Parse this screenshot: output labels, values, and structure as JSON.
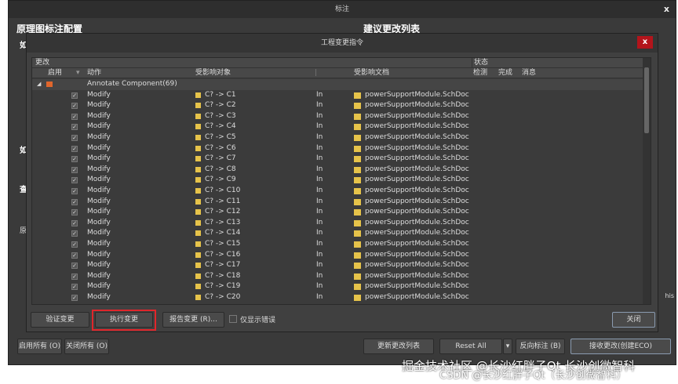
{
  "window": {
    "title": "标注",
    "close": "x",
    "left_section": "原理图标注配置",
    "right_section": "建议更改列表",
    "left_frag": [
      "如",
      "如",
      "查",
      "原"
    ]
  },
  "dialog": {
    "title": "工程变更指令",
    "close": "x",
    "header": {
      "group": "更改",
      "status": "状态",
      "cols": [
        "启用",
        "动作",
        "受影响对象",
        "受影响文档",
        "检测",
        "完成",
        "消息"
      ]
    },
    "group_row": "Annotate Component(69)",
    "rows": [
      {
        "action": "Modify",
        "object": "C? -> C1",
        "dir": "In",
        "doc": "powerSupportModule.SchDoc"
      },
      {
        "action": "Modify",
        "object": "C? -> C2",
        "dir": "In",
        "doc": "powerSupportModule.SchDoc"
      },
      {
        "action": "Modify",
        "object": "C? -> C3",
        "dir": "In",
        "doc": "powerSupportModule.SchDoc"
      },
      {
        "action": "Modify",
        "object": "C? -> C4",
        "dir": "In",
        "doc": "powerSupportModule.SchDoc"
      },
      {
        "action": "Modify",
        "object": "C? -> C5",
        "dir": "In",
        "doc": "powerSupportModule.SchDoc"
      },
      {
        "action": "Modify",
        "object": "C? -> C6",
        "dir": "In",
        "doc": "powerSupportModule.SchDoc"
      },
      {
        "action": "Modify",
        "object": "C? -> C7",
        "dir": "In",
        "doc": "powerSupportModule.SchDoc"
      },
      {
        "action": "Modify",
        "object": "C? -> C8",
        "dir": "In",
        "doc": "powerSupportModule.SchDoc"
      },
      {
        "action": "Modify",
        "object": "C? -> C9",
        "dir": "In",
        "doc": "powerSupportModule.SchDoc"
      },
      {
        "action": "Modify",
        "object": "C? -> C10",
        "dir": "In",
        "doc": "powerSupportModule.SchDoc"
      },
      {
        "action": "Modify",
        "object": "C? -> C11",
        "dir": "In",
        "doc": "powerSupportModule.SchDoc"
      },
      {
        "action": "Modify",
        "object": "C? -> C12",
        "dir": "In",
        "doc": "powerSupportModule.SchDoc"
      },
      {
        "action": "Modify",
        "object": "C? -> C13",
        "dir": "In",
        "doc": "powerSupportModule.SchDoc"
      },
      {
        "action": "Modify",
        "object": "C? -> C14",
        "dir": "In",
        "doc": "powerSupportModule.SchDoc"
      },
      {
        "action": "Modify",
        "object": "C? -> C15",
        "dir": "In",
        "doc": "powerSupportModule.SchDoc"
      },
      {
        "action": "Modify",
        "object": "C? -> C16",
        "dir": "In",
        "doc": "powerSupportModule.SchDoc"
      },
      {
        "action": "Modify",
        "object": "C? -> C17",
        "dir": "In",
        "doc": "powerSupportModule.SchDoc"
      },
      {
        "action": "Modify",
        "object": "C? -> C18",
        "dir": "In",
        "doc": "powerSupportModule.SchDoc"
      },
      {
        "action": "Modify",
        "object": "C? -> C19",
        "dir": "In",
        "doc": "powerSupportModule.SchDoc"
      },
      {
        "action": "Modify",
        "object": "C? -> C20",
        "dir": "In",
        "doc": "powerSupportModule.SchDoc"
      }
    ],
    "buttons": {
      "validate": "验证变更",
      "execute": "执行变更",
      "report": "报告变更 (R)...",
      "only_errors": "仅显示错误",
      "close": "关闭"
    }
  },
  "outer_buttons": {
    "enable_all": "启用所有 (O)",
    "disable_all": "关闭所有 (O)",
    "update": "更新更改列表",
    "reset": "Reset All",
    "back_annotate": "反向标注 (B)",
    "accept": "接收更改(创建ECO)"
  },
  "right_frag": "his",
  "watermark": [
    "掘金技术社区 @长沙红胖子Qt 长沙创微智科",
    "CSDN @长沙红胖子Qt（长沙创微智科）"
  ]
}
